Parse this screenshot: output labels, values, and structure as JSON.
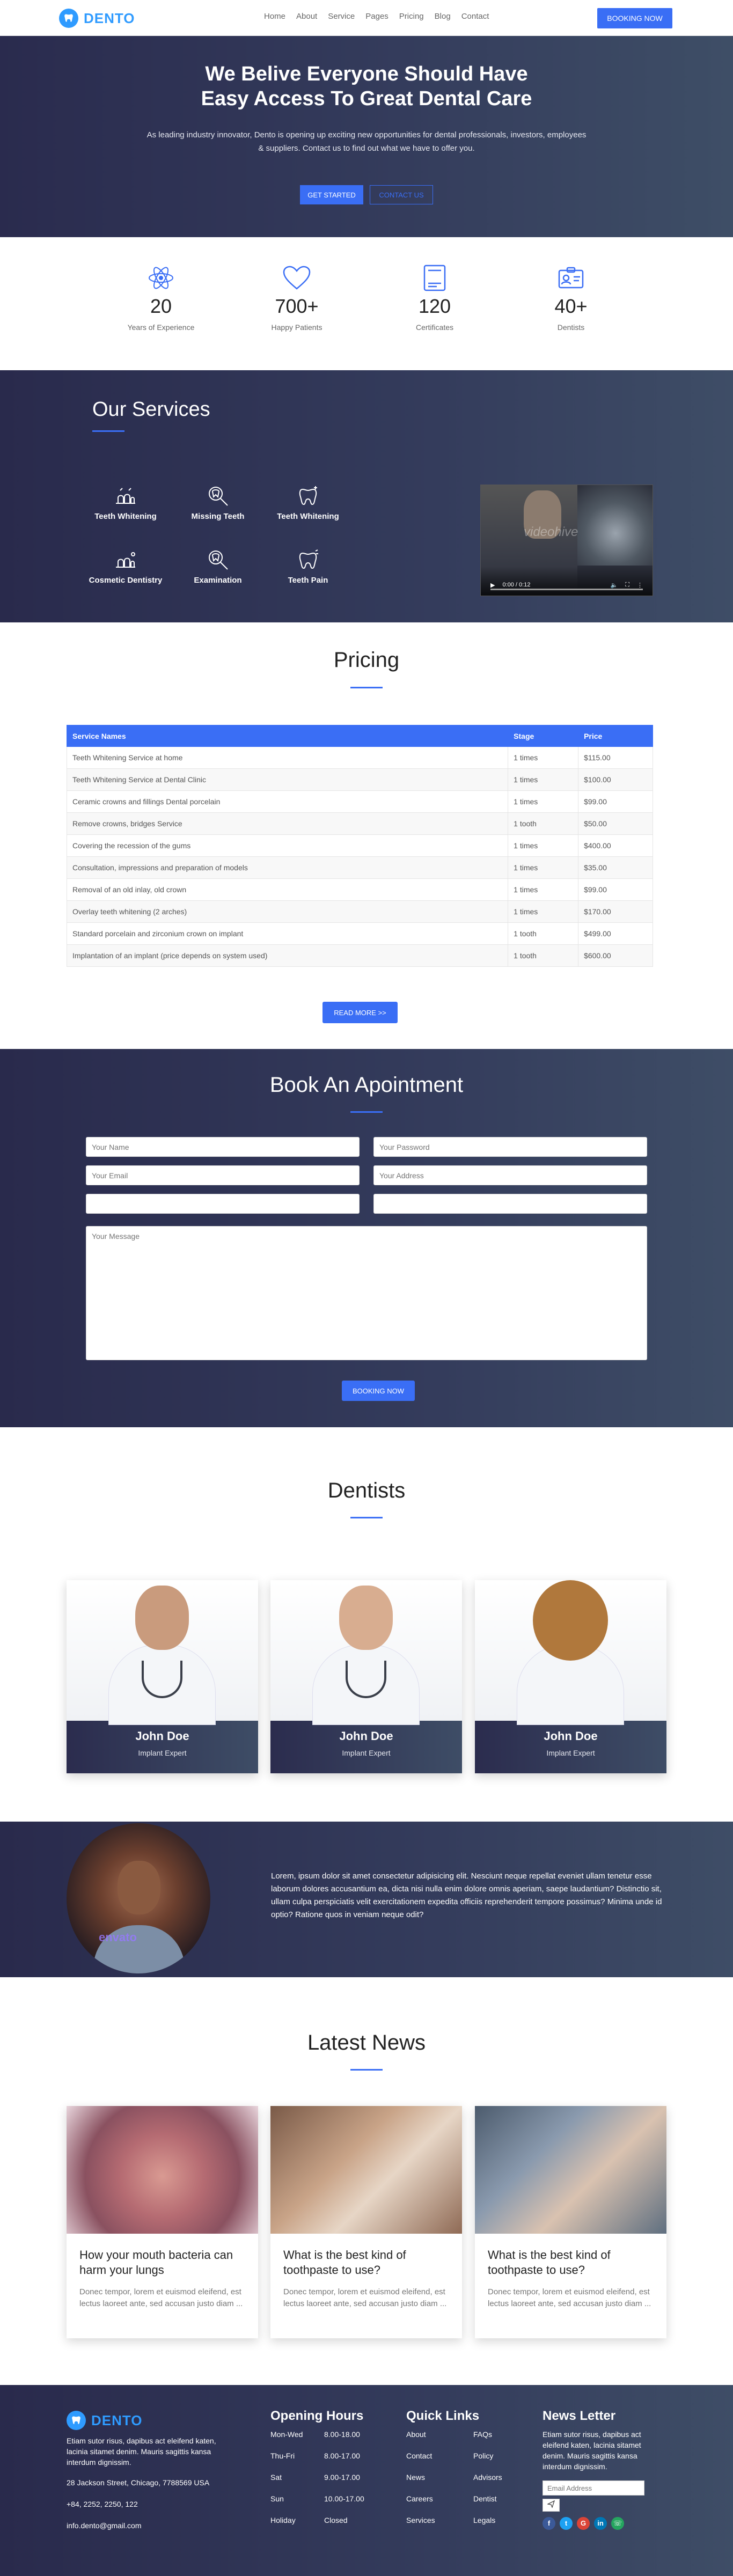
{
  "brand": {
    "name": "DENTO"
  },
  "nav": {
    "items": [
      "Home",
      "About",
      "Service",
      "Pages",
      "Pricing",
      "Blog",
      "Contact"
    ],
    "cta": "BOOKING NOW"
  },
  "hero": {
    "title_line1": "We Belive Everyone Should Have",
    "title_line2": "Easy Access To Great Dental Care",
    "text": "As leading industry innovator, Dento is opening up exciting new opportunities for dental professionals, investors, employees & suppliers. Contact us to find out what we have to offer you.",
    "btn_primary": "GET STARTED",
    "btn_secondary": "CONTACT US"
  },
  "stats": [
    {
      "icon": "atom-icon",
      "value": "20",
      "label": "Years of Experience"
    },
    {
      "icon": "heart-icon",
      "value": "700+",
      "label": "Happy Patients"
    },
    {
      "icon": "certificate-icon",
      "value": "120",
      "label": "Certificates"
    },
    {
      "icon": "id-card-icon",
      "value": "40+",
      "label": "Dentists"
    }
  ],
  "services": {
    "title": "Our Services",
    "items": [
      {
        "icon": "teeth-whitening-icon",
        "label": "Teeth Whitening"
      },
      {
        "icon": "missing-teeth-icon",
        "label": "Missing Teeth"
      },
      {
        "icon": "tooth-sparkle-icon",
        "label": "Teeth Whitening"
      },
      {
        "icon": "cosmetic-dentistry-icon",
        "label": "Cosmetic Dentistry"
      },
      {
        "icon": "examination-icon",
        "label": "Examination"
      },
      {
        "icon": "teeth-pain-icon",
        "label": "Teeth Pain"
      }
    ],
    "video": {
      "watermark": "videohive",
      "time": "0:00 / 0:12"
    }
  },
  "pricing": {
    "title": "Pricing",
    "columns": [
      "Service Names",
      "Stage",
      "Price"
    ],
    "rows": [
      [
        "Teeth Whitening Service at home",
        "1 times",
        "$115.00"
      ],
      [
        "Teeth Whitening Service at Dental Clinic",
        "1 times",
        "$100.00"
      ],
      [
        "Ceramic crowns and fillings Dental porcelain",
        "1 times",
        "$99.00"
      ],
      [
        "Remove crowns, bridges Service",
        "1 tooth",
        "$50.00"
      ],
      [
        "Covering the recession of the gums",
        "1 times",
        "$400.00"
      ],
      [
        "Consultation, impressions and preparation of models",
        "1 times",
        "$35.00"
      ],
      [
        "Removal of an old inlay, old crown",
        "1 times",
        "$99.00"
      ],
      [
        "Overlay teeth whitening (2 arches)",
        "1 times",
        "$170.00"
      ],
      [
        "Standard porcelain and zirconium crown on implant",
        "1 tooth",
        "$499.00"
      ],
      [
        "Implantation of an implant (price depends on system used)",
        "1 tooth",
        "$600.00"
      ]
    ],
    "read_more": "READ MORE >>"
  },
  "appointment": {
    "title": "Book An Apointment",
    "name_placeholder": "Your Name",
    "password_placeholder": "Your Password",
    "email_placeholder": "Your Email",
    "address_placeholder": "Your Address",
    "blank1_placeholder": "",
    "blank2_placeholder": "",
    "message_placeholder": "Your Message",
    "submit": "BOOKING NOW"
  },
  "dentists": {
    "title": "Dentists",
    "items": [
      {
        "name": "John Doe",
        "role": "Implant Expert"
      },
      {
        "name": "John Doe",
        "role": "Implant Expert"
      },
      {
        "name": "John Doe",
        "role": "Implant Expert"
      }
    ]
  },
  "testimonial": {
    "text": "Lorem, ipsum dolor sit amet consectetur adipisicing elit. Nesciunt neque repellat eveniet ullam tenetur esse laborum dolores accusantium ea, dicta nisi nulla enim dolore omnis aperiam, saepe laudantium? Distinctio sit, ullam culpa perspiciatis velit exercitationem expedita officiis reprehenderit tempore possimus? Minima unde id optio? Ratione quos in veniam neque odit?",
    "watermark": "envato"
  },
  "news": {
    "title": "Latest News",
    "items": [
      {
        "title": "How your mouth bacteria can harm your lungs",
        "excerpt": "Donec tempor, lorem et euismod eleifend, est lectus laoreet ante, sed accusan justo diam ..."
      },
      {
        "title": "What is the best kind of toothpaste to use?",
        "excerpt": "Donec tempor, lorem et euismod eleifend, est lectus laoreet ante, sed accusan justo diam ..."
      },
      {
        "title": "What is the best kind of toothpaste to use?",
        "excerpt": "Donec tempor, lorem et euismod eleifend, est lectus laoreet ante, sed accusan justo diam ..."
      }
    ]
  },
  "footer": {
    "about": "Etiam sutor risus, dapibus act eleifend katen, lacinia sitamet denim. Mauris sagittis kansa interdum dignissim.",
    "address": "28 Jackson Street, Chicago, 7788569 USA",
    "phone": "+84, 2252, 2250, 122",
    "email": "info.dento@gmail.com",
    "hours_title": "Opening Hours",
    "hours": [
      {
        "day": "Mon-Wed",
        "time": "8.00-18.00"
      },
      {
        "day": "Thu-Fri",
        "time": "8.00-17.00"
      },
      {
        "day": "Sat",
        "time": "9.00-17.00"
      },
      {
        "day": "Sun",
        "time": "10.00-17.00"
      },
      {
        "day": "Holiday",
        "time": "Closed"
      }
    ],
    "links_title": "Quick Links",
    "links_col1": [
      "About",
      "Contact",
      "News",
      "Careers",
      "Services"
    ],
    "links_col2": [
      "FAQs",
      "Policy",
      "Advisors",
      "Dentist",
      "Legals"
    ],
    "newsletter_title": "News Letter",
    "newsletter_text": "Etiam sutor risus, dapibus act eleifend katen, lacinia sitamet denim. Mauris sagittis kansa interdum dignissim.",
    "newsletter_placeholder": "Email Address"
  },
  "colors": {
    "accent": "#3a6ef5",
    "brand": "#2f9bff",
    "dark": "#2a2b4e"
  }
}
